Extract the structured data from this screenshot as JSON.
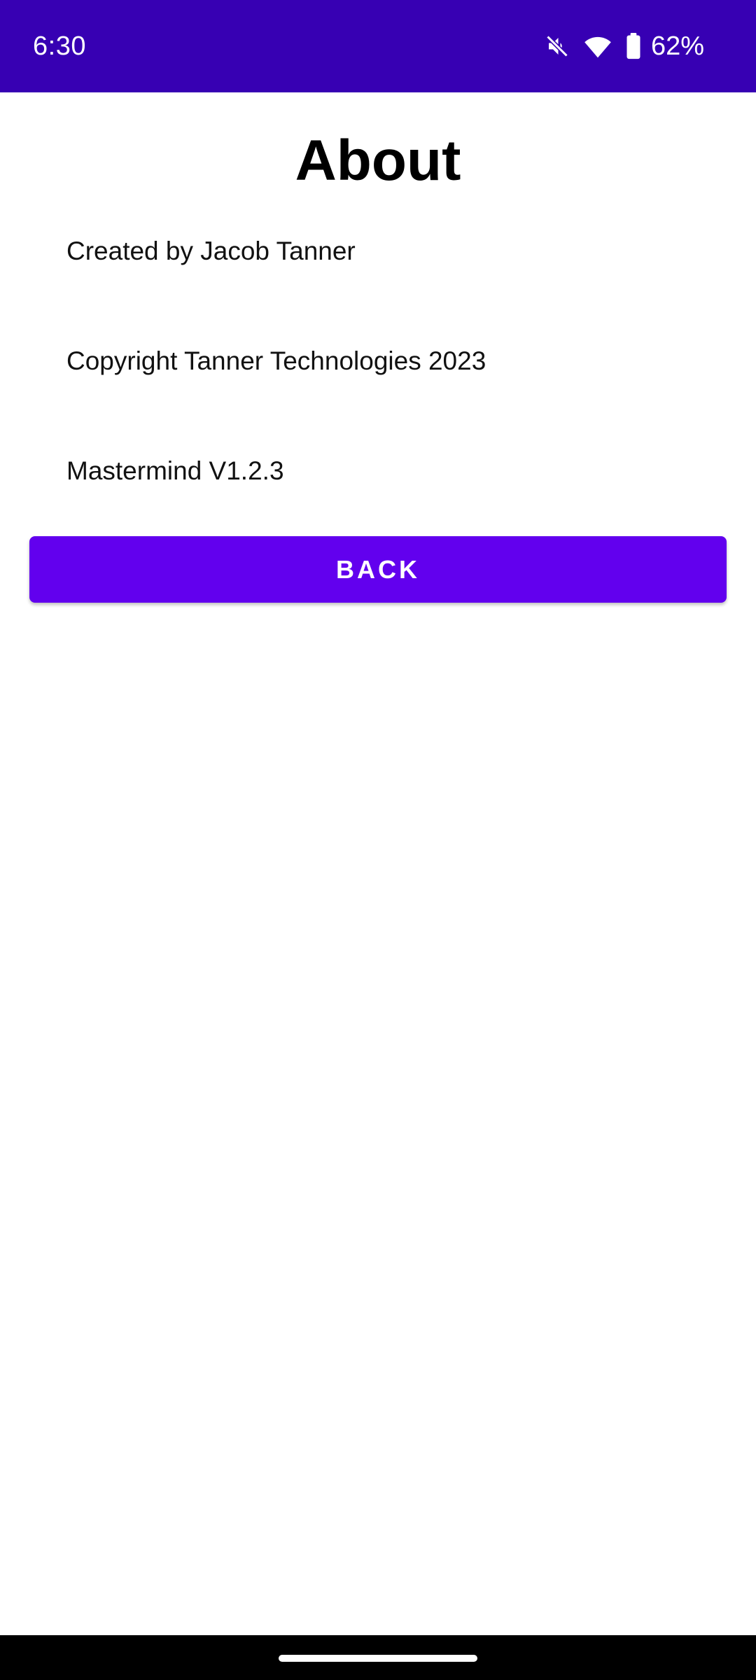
{
  "status_bar": {
    "time": "6:30",
    "battery_percent": "62%",
    "icons": [
      "mute-icon",
      "wifi-icon",
      "battery-icon"
    ],
    "background_color": "#3700b3"
  },
  "page": {
    "title": "About",
    "lines": [
      "Created by Jacob Tanner",
      "Copyright Tanner Technologies 2023",
      "Mastermind V1.2.3"
    ]
  },
  "actions": {
    "back_label": "BACK",
    "button_color": "#6200ee"
  },
  "nav_bar": {
    "icons": [
      "home-handle"
    ]
  }
}
